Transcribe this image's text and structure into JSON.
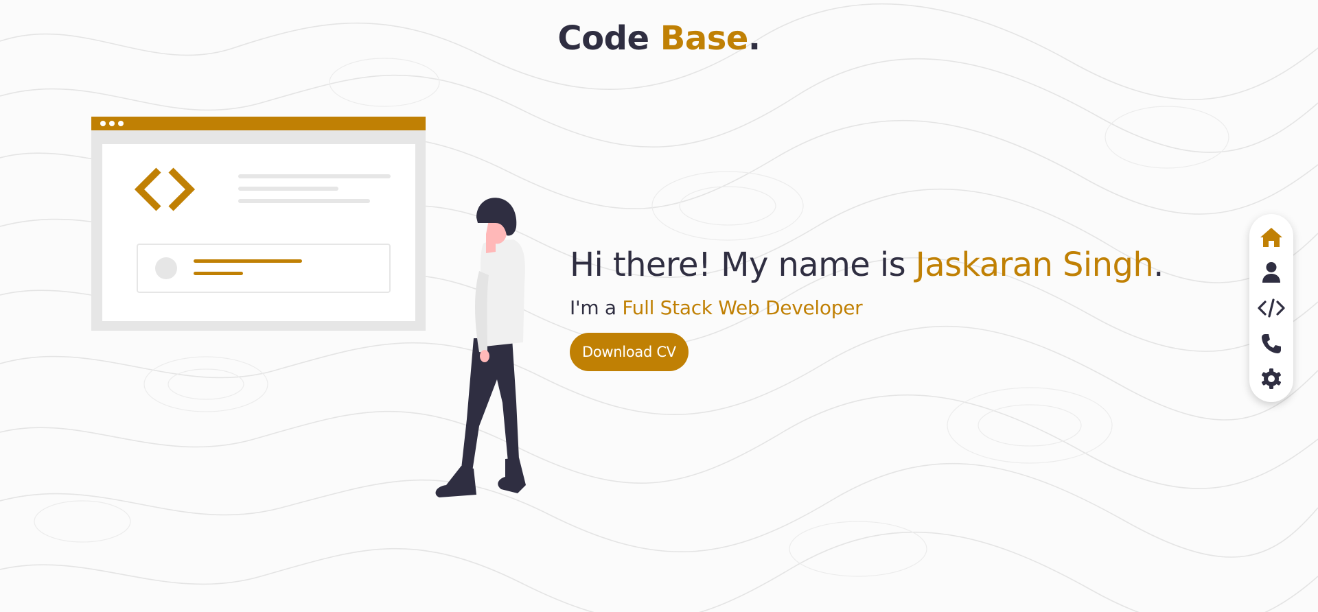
{
  "brand": {
    "logo_main": "Code",
    "logo_accent": "Base",
    "logo_dot": "."
  },
  "hero": {
    "greeting": "Hi there! My name is",
    "name": "Jaskaran Singh",
    "name_dot": ".",
    "role_prefix": "I'm a",
    "role": "Full Stack Web Developer",
    "cta_label": "Download CV"
  },
  "side_nav": {
    "items": [
      {
        "icon": "home-icon",
        "active": true
      },
      {
        "icon": "user-icon",
        "active": false
      },
      {
        "icon": "code-icon",
        "active": false
      },
      {
        "icon": "phone-icon",
        "active": false
      },
      {
        "icon": "settings-gear-icon",
        "active": false
      }
    ]
  },
  "colors": {
    "accent": "#c08004",
    "dark": "#2f2e41",
    "background": "#fbfbfb"
  }
}
